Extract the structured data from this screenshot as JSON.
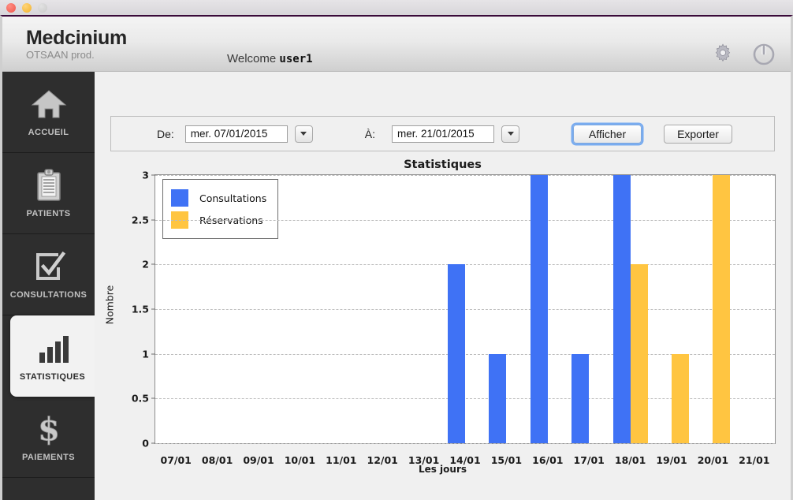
{
  "window": {
    "traffic_lights": [
      "close",
      "minimize",
      "zoom"
    ]
  },
  "header": {
    "brand_name": "Medcinium",
    "brand_sub": "OTSAAN prod.",
    "welcome_prefix": "Welcome",
    "welcome_user": "user1",
    "settings_icon": "gear-icon",
    "power_icon": "power-icon"
  },
  "sidebar": {
    "items": [
      {
        "label": "ACCUEIL",
        "icon": "home-icon",
        "active": false
      },
      {
        "label": "PATIENTS",
        "icon": "clipboard-icon",
        "active": false
      },
      {
        "label": "CONSULTATIONS",
        "icon": "checkbox-icon",
        "active": false
      },
      {
        "label": "STATISTIQUES",
        "icon": "bar-chart-icon",
        "active": true
      },
      {
        "label": "PAIEMENTS",
        "icon": "dollar-icon",
        "active": false
      }
    ]
  },
  "toolbar": {
    "from_label": "De:",
    "from_value": "mer. 07/01/2015",
    "to_label": "À:",
    "to_value": "mer. 21/01/2015",
    "show_button": "Afficher",
    "export_button": "Exporter",
    "stepper_icon": "chevron-down-icon"
  },
  "chart_data": {
    "type": "bar",
    "title": "Statistiques",
    "xlabel": "Les jours",
    "ylabel": "Nombre",
    "categories": [
      "07/01",
      "08/01",
      "09/01",
      "10/01",
      "11/01",
      "12/01",
      "13/01",
      "14/01",
      "15/01",
      "16/01",
      "17/01",
      "18/01",
      "19/01",
      "20/01",
      "21/01"
    ],
    "series": [
      {
        "name": "Consultations",
        "color": "#3f72f5",
        "values": [
          0,
          0,
          0,
          0,
          0,
          0,
          0,
          2,
          1,
          3,
          1,
          3,
          0,
          0,
          0
        ]
      },
      {
        "name": "Réservations",
        "color": "#ffc541",
        "values": [
          0,
          0,
          0,
          0,
          0,
          0,
          0,
          0,
          0,
          0,
          0,
          2,
          1,
          3,
          0
        ]
      }
    ],
    "ylim": [
      0,
      3
    ],
    "yticks": [
      "0",
      "0.5",
      "1",
      "1.5",
      "2",
      "2.5",
      "3"
    ],
    "ytick_values": [
      0,
      0.5,
      1,
      1.5,
      2,
      2.5,
      3
    ],
    "grid": true,
    "legend_position": "top-left"
  }
}
